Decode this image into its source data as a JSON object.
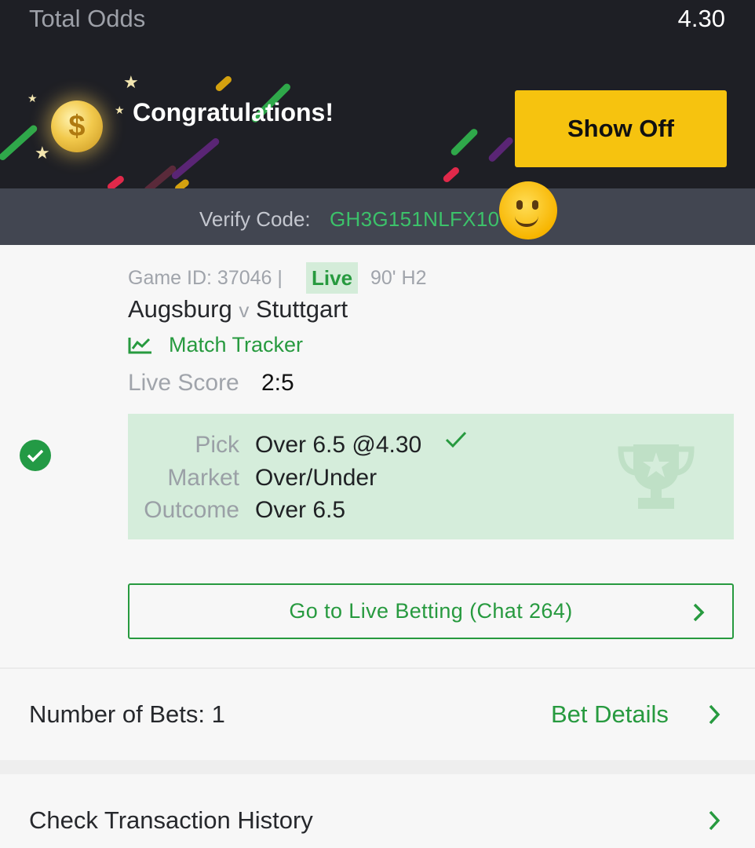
{
  "header": {
    "total_odds_label": "Total Odds",
    "total_odds_value": "4.30",
    "congrats_text": "Congratulations!",
    "show_off_label": "Show Off"
  },
  "verify": {
    "label": "Verify Code:",
    "code": "GH3G151NLFX10"
  },
  "ticket": {
    "game_id_text": "Game ID: 37046 |",
    "live_badge": "Live",
    "game_time": "90' H2",
    "home_team": "Augsburg",
    "vs": "v",
    "away_team": "Stuttgart",
    "match_tracker_label": "Match Tracker",
    "live_score_label": "Live Score",
    "live_score_value": "2:5",
    "pick_label": "Pick",
    "pick_value": "Over 6.5 @4.30",
    "market_label": "Market",
    "market_value": "Over/Under",
    "outcome_label": "Outcome",
    "outcome_value": "Over 6.5",
    "live_betting_label": "Go to Live Betting (Chat 264)"
  },
  "summary": {
    "number_of_bets_label": "Number of Bets: 1",
    "bet_details_label": "Bet Details",
    "transaction_history_label": "Check Transaction History"
  },
  "colors": {
    "accent_green": "#279a3f",
    "show_off_yellow": "#f6c30f",
    "header_dark": "#1e1f25",
    "verify_bar": "#424651",
    "pick_box_bg": "#d5eddb"
  },
  "icons": [
    "coin-icon",
    "melting-face-emoji",
    "match-tracker-icon",
    "won-check-icon",
    "pick-check-icon",
    "trophy-icon",
    "chevron-right-icon"
  ]
}
